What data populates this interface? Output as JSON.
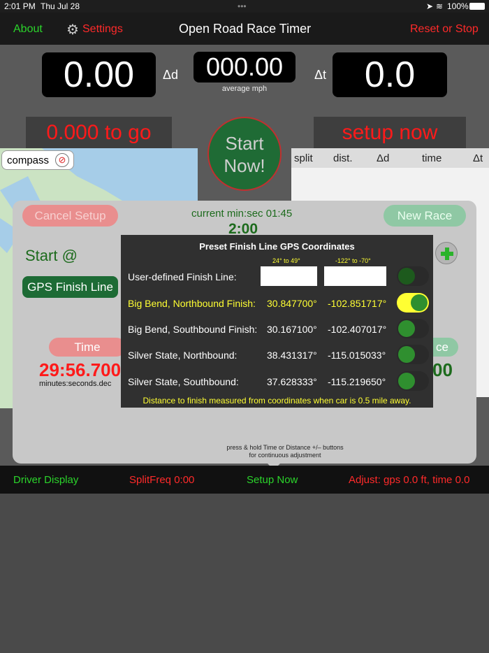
{
  "status": {
    "time": "2:01 PM",
    "date": "Thu Jul 28",
    "battery": "100%"
  },
  "nav": {
    "about": "About",
    "settings": "Settings",
    "title": "Open Road Race Timer",
    "reset": "Reset or Stop"
  },
  "display": {
    "distance": "0.00",
    "delta_d": "Δd",
    "speed": "000.00",
    "speed_unit": "average mph",
    "delta_t": "Δt",
    "time": "0.0",
    "to_go": "0.000 to go",
    "setup_now": "setup now",
    "start_button": "Start Now!"
  },
  "map": {
    "compass": "compass"
  },
  "splits": {
    "headers": [
      "split",
      "dist.",
      "Δd",
      "time",
      "Δt"
    ]
  },
  "setup": {
    "cancel": "Cancel Setup",
    "current": "current min:sec 01:45",
    "current_value": "2:00",
    "new_race": "New Race",
    "start_at": "Start @",
    "gps_finish": "GPS Finish Line",
    "time_label": "Time",
    "time_value": "29:56.700",
    "time_unit": "minutes:seconds.dec",
    "right_label": "ce",
    "right_value": "00",
    "hint": "press & hold Time or Distance +/– buttons\nfor continuous adjustment"
  },
  "preset": {
    "title": "Preset Finish Line GPS Coordinates",
    "lat_range": "24° to 49°",
    "lon_range": "-122° to -70°",
    "rows": [
      {
        "label": "User-defined Finish Line:",
        "lat": "",
        "lon": "",
        "on": false,
        "highlight": false
      },
      {
        "label": "Big Bend, Northbound Finish:",
        "lat": "30.847700°",
        "lon": "-102.851717°",
        "on": true,
        "highlight": true
      },
      {
        "label": "Big Bend, Southbound Finish:",
        "lat": "30.167100°",
        "lon": "-102.407017°",
        "on": false,
        "highlight": false
      },
      {
        "label": "Silver State, Northbound:",
        "lat": "38.431317°",
        "lon": "-115.015033°",
        "on": false,
        "highlight": false
      },
      {
        "label": "Silver State, Southbound:",
        "lat": "37.628333°",
        "lon": "-115.219650°",
        "on": false,
        "highlight": false
      }
    ],
    "note": "Distance to finish measured from coordinates when car is 0.5 mile away."
  },
  "tabs": {
    "driver": "Driver Display",
    "split": "SplitFreq 0:00",
    "setup": "Setup Now",
    "adjust": "Adjust: gps 0.0 ft, time 0.0"
  },
  "colors": {
    "green": "#2bd42b",
    "red": "#ff2a2a",
    "yellow": "#ffff33"
  }
}
